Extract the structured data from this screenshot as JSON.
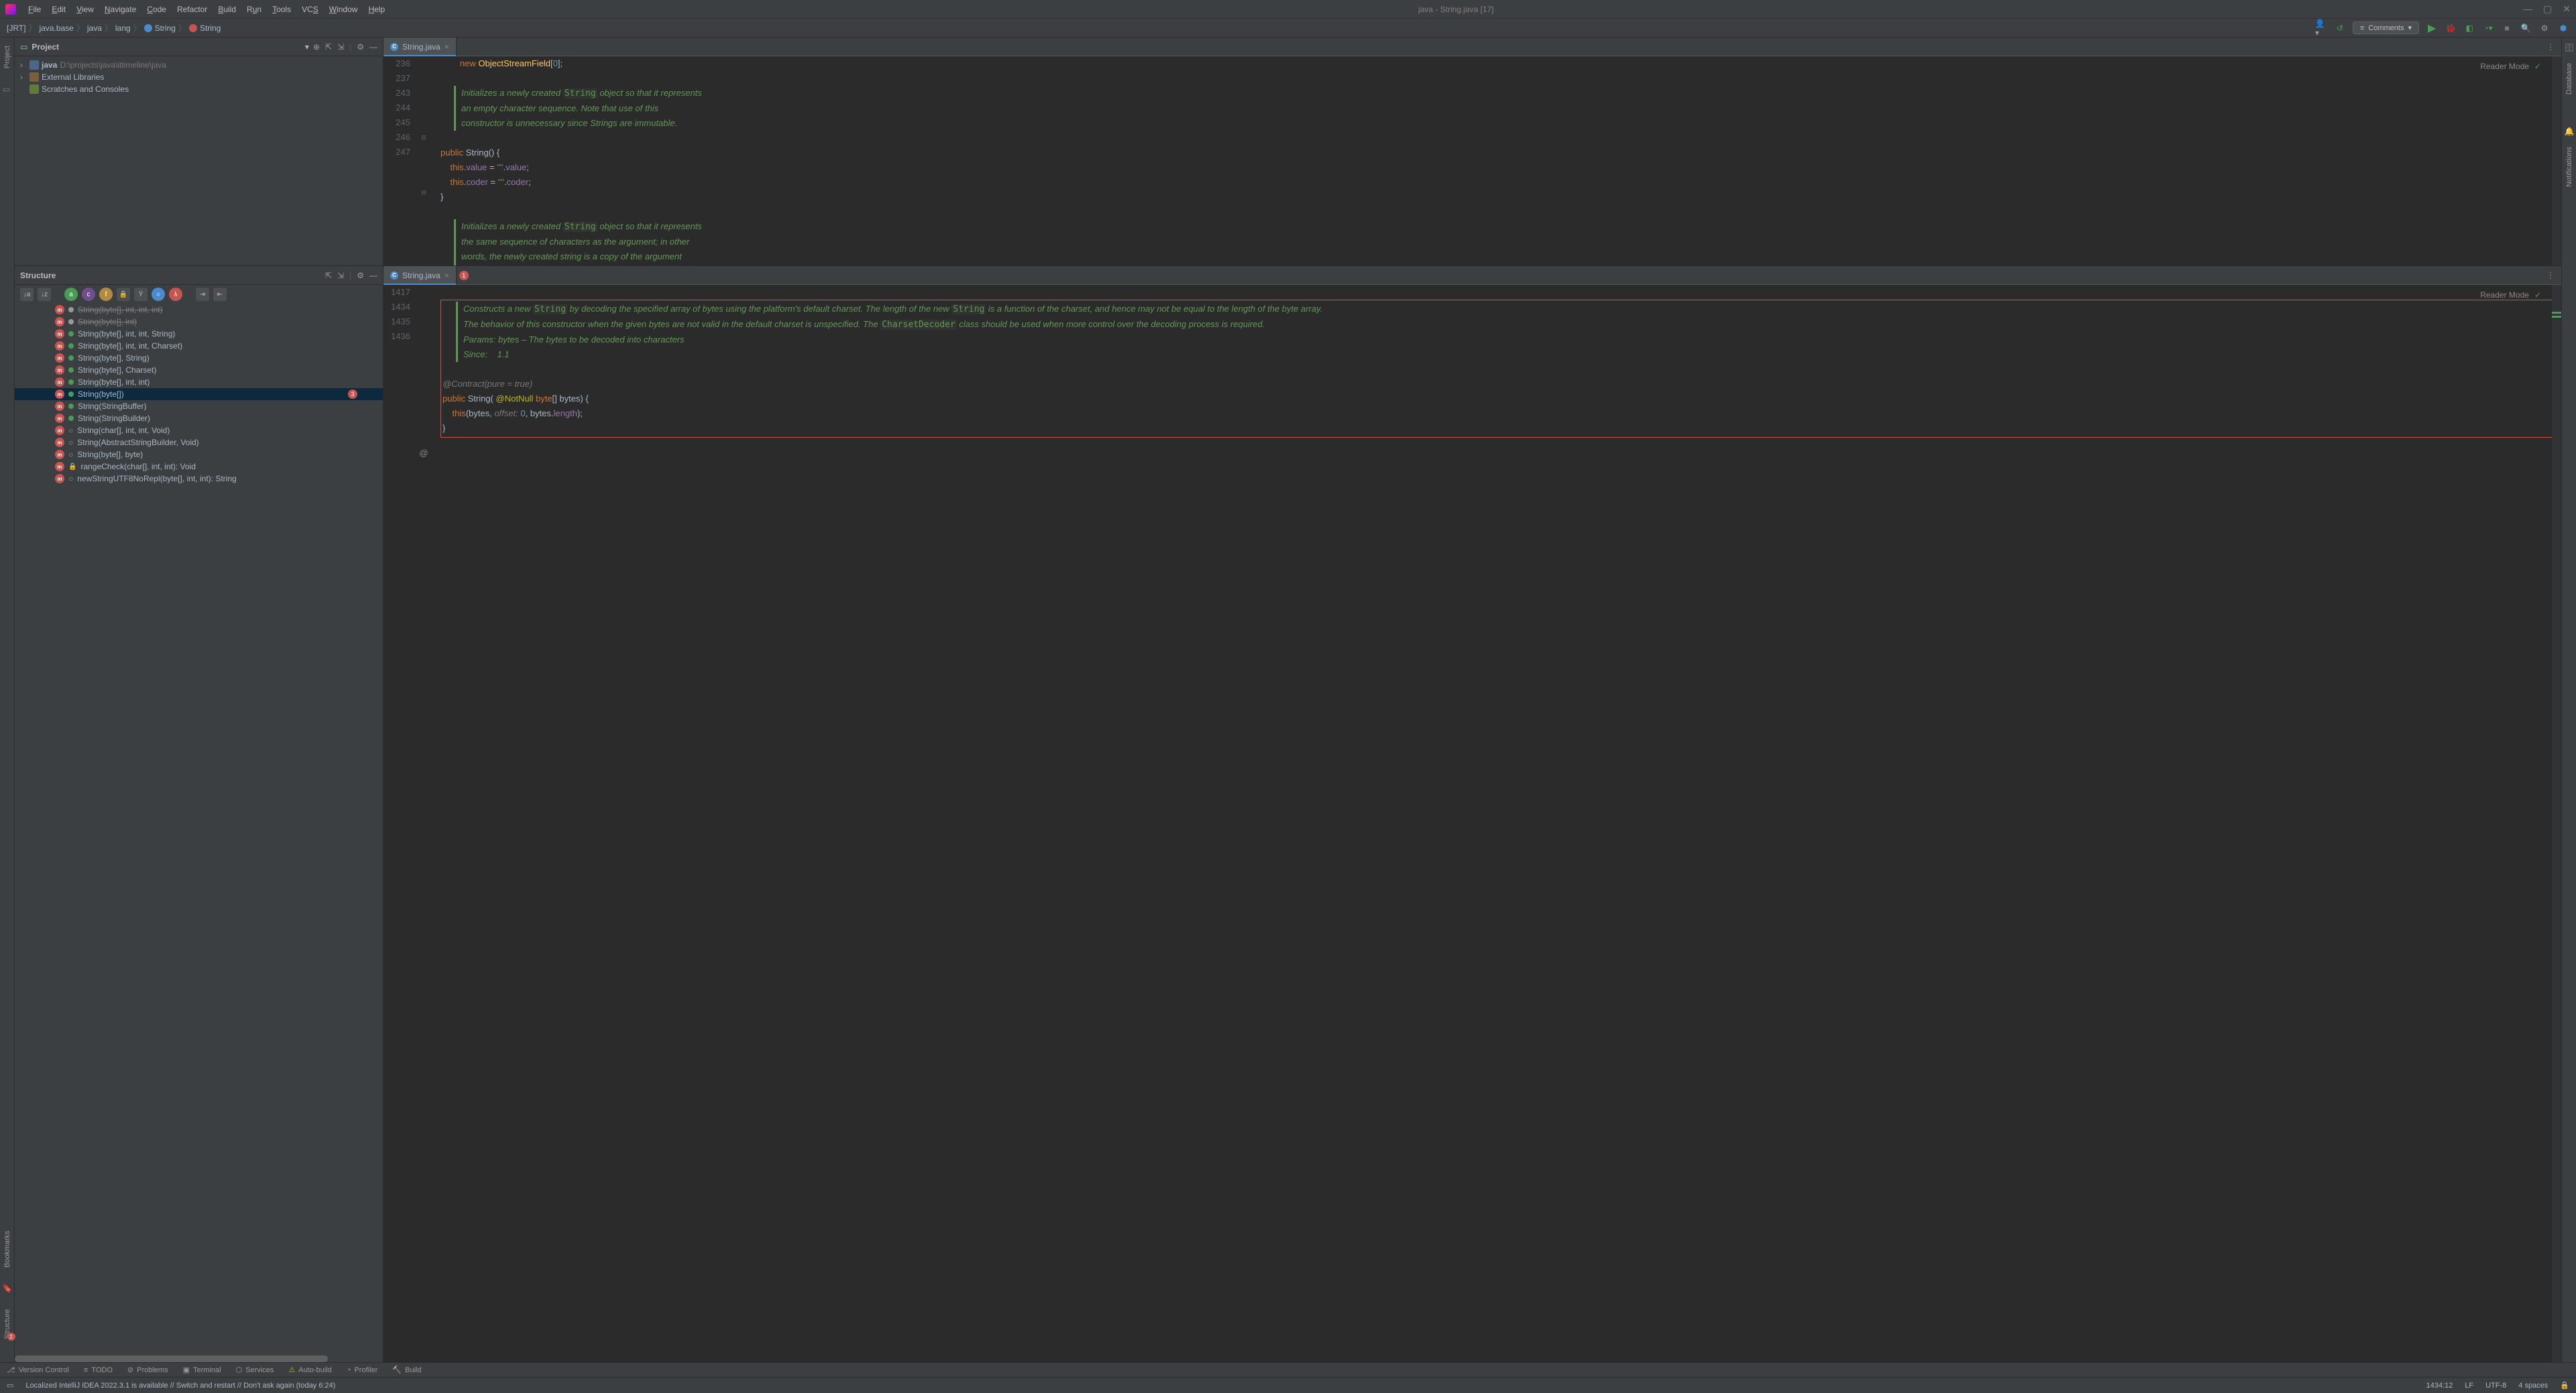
{
  "app": {
    "title_text": "java - String.java [17]",
    "menu": [
      "File",
      "Edit",
      "View",
      "Navigate",
      "Code",
      "Refactor",
      "Build",
      "Run",
      "Tools",
      "VCS",
      "Window",
      "Help"
    ],
    "menu_underline": [
      "F",
      "E",
      "V",
      "N",
      "C",
      "",
      "B",
      "R",
      "T",
      "",
      "W",
      "H"
    ]
  },
  "breadcrumb": {
    "root": "[JRT]",
    "parts": [
      "java.base",
      "java",
      "lang",
      "String",
      "String"
    ]
  },
  "combo": {
    "label": "Comments"
  },
  "project": {
    "title": "Project",
    "root_name": "java",
    "root_path": "D:\\projects\\java\\ittimeline\\java",
    "external_libs": "External Libraries",
    "scratches": "Scratches and Consoles"
  },
  "structure": {
    "title": "Structure",
    "items": [
      {
        "label": "String(byte[], int, int, int)",
        "vis": "pkg",
        "deprecated": true
      },
      {
        "label": "String(byte[], int)",
        "vis": "pkg",
        "deprecated": true
      },
      {
        "label": "String(byte[], int, int, String)",
        "vis": "pub"
      },
      {
        "label": "String(byte[], int, int, Charset)",
        "vis": "pub"
      },
      {
        "label": "String(byte[], String)",
        "vis": "pub"
      },
      {
        "label": "String(byte[], Charset)",
        "vis": "pub"
      },
      {
        "label": "String(byte[], int, int)",
        "vis": "pub"
      },
      {
        "label": "String(byte[])",
        "vis": "pub",
        "selected": true,
        "badge": "3"
      },
      {
        "label": "String(StringBuffer)",
        "vis": "pub"
      },
      {
        "label": "String(StringBuilder)",
        "vis": "pub"
      },
      {
        "label": "String(char[], int, int, Void)",
        "vis": "pkg",
        "open": true
      },
      {
        "label": "String(AbstractStringBuilder, Void)",
        "vis": "pkg",
        "open": true
      },
      {
        "label": "String(byte[], byte)",
        "vis": "pkg",
        "open": true
      },
      {
        "label": "rangeCheck(char[], int, int): Void",
        "vis": "priv",
        "lock": true
      },
      {
        "label": "newStringUTF8NoRepl(byte[], int, int): String",
        "vis": "pkg",
        "open": true
      }
    ]
  },
  "editor_tab": {
    "name": "String.java"
  },
  "reader_mode": "Reader Mode",
  "code_top": {
    "lines": [
      {
        "n": "236",
        "txt": "            new ObjectStreamField[0];"
      },
      {
        "n": "237",
        "txt": ""
      },
      {
        "n": "",
        "doc": "Initializes a newly created String object so that it represents an empty character sequence. Note that use of this constructor is unnecessary since Strings are immutable."
      },
      {
        "n": "243",
        "txt": "    public String() {"
      },
      {
        "n": "244",
        "txt": "        this.value = \"\".value;"
      },
      {
        "n": "245",
        "txt": "        this.coder = \"\".coder;"
      },
      {
        "n": "246",
        "txt": "    }"
      },
      {
        "n": "247",
        "txt": ""
      },
      {
        "n": "",
        "doc": "Initializes a newly created String object so that it represents the same sequence of characters as the argument; in other words, the newly created string is a copy of the argument string. Unless an explicit copy of original is needed, use of this constructor is unnecessary since Strings are immutable."
      }
    ]
  },
  "code_bottom": {
    "badge": "1",
    "lines_start": "1417",
    "doc1_a": "Constructs a new ",
    "doc1_b": " by decoding the specified array of bytes using the platform's default charset. The length of the new ",
    "doc1_c": " is a function of the charset, and hence may not be equal to the length of the byte array.",
    "doc2_a": "The behavior of this constructor when the given bytes are not valid in the default charset is unspecified. The ",
    "doc2_b": " class should be used when more control over the decoding process is required.",
    "doc3": "Params: bytes – The bytes to be decoded into characters",
    "doc4_label": "Since:",
    "doc4_val": "1.1",
    "contract": "@Contract(pure = true)",
    "sig_line_n": "1434",
    "sig_at": "@",
    "sig_txt_pub": "public ",
    "sig_txt_cls": "String",
    "sig_txt_open": "(",
    "sig_ann": " @NotNull ",
    "sig_kw": "byte",
    "sig_rest": "[] bytes) {",
    "body_n": "1435",
    "body_this": "this",
    "body_open": "(bytes, ",
    "body_hint": "offset:",
    "body_zero": " 0",
    "body_comma": ", bytes.",
    "body_len": "length",
    "body_close": ");",
    "close_n": "1436",
    "close_txt": "    }"
  },
  "right_sidebar": {
    "database": "Database",
    "notifications": "Notifications"
  },
  "left_sidebar_bottom": {
    "bookmarks": "Bookmarks",
    "structure": "Structure",
    "badge": "2"
  },
  "toolstrip": {
    "items": [
      "Version Control",
      "TODO",
      "Problems",
      "Terminal",
      "Services",
      "Auto-build",
      "Profiler",
      "Build"
    ]
  },
  "statusbar": {
    "msg": "Localized IntelliJ IDEA 2022.3.1 is available // Switch and restart // Don't ask again (today 6:24)",
    "pos": "1434:12",
    "sep": "LF",
    "enc": "UTF-8",
    "indent": "4 spaces"
  }
}
